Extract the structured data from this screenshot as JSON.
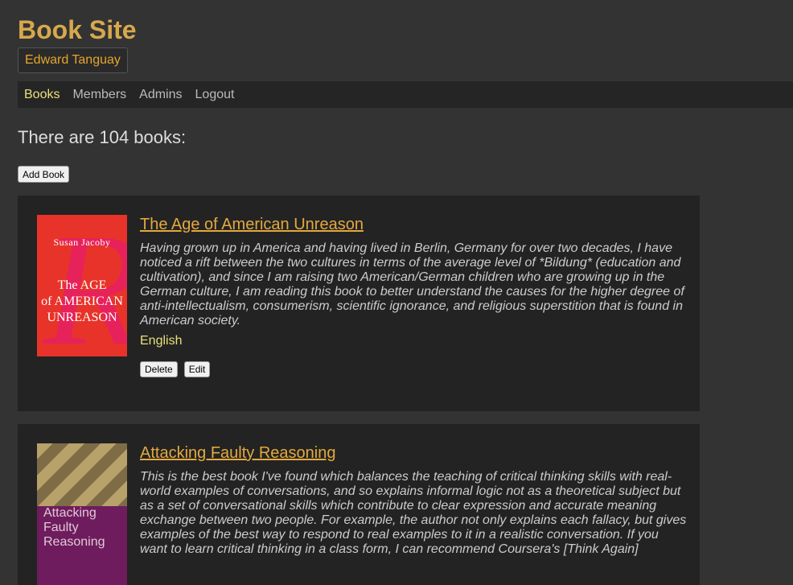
{
  "header": {
    "site_title": "Book Site",
    "user_name": "Edward Tanguay"
  },
  "nav": {
    "items": [
      {
        "label": "Books",
        "active": true
      },
      {
        "label": "Members",
        "active": false
      },
      {
        "label": "Admins",
        "active": false
      },
      {
        "label": "Logout",
        "active": false
      }
    ]
  },
  "main": {
    "count_text": "There are 104 books:",
    "add_button_label": "Add Book"
  },
  "books": [
    {
      "title": "The Age of American Unreason",
      "description": "Having grown up in America and having lived in Berlin, Germany for over two decades, I have noticed a rift between the two cultures in terms of the average level of *Bildung* (education and cultivation), and since I am raising two American/German children who are growing up in the German culture, I am reading this book to better understand the causes for the higher degree of anti-intellectualism, consumerism, scientific ignorance, and religious superstition that is found in American society.",
      "language": "English",
      "delete_label": "Delete",
      "edit_label": "Edit",
      "cover": {
        "author": "Susan Jacoby",
        "title_lines": [
          "The AGE",
          "of AMERICAN",
          "UNREASON"
        ]
      }
    },
    {
      "title": "Attacking Faulty Reasoning",
      "description": "This is the best book I've found which balances the teaching of critical thinking skills with real-world examples of conversations, and so explains informal logic not as a theoretical subject but as a set of conversational skills which contribute to clear expression and accurate meaning exchange between two people. For example, the author not only explains each fallacy, but gives examples of the best way to respond to real examples to it in a realistic conversation. If you want to learn critical thinking in a class form, I can recommend Coursera's [Think Again]",
      "cover": {
        "title_lines": [
          "Attacking",
          "Faulty",
          "Reasoning"
        ]
      }
    }
  ],
  "colors": {
    "accent": "#d7a94c",
    "nav_active": "#e8e07a",
    "background": "#333333",
    "card": "#232323"
  }
}
